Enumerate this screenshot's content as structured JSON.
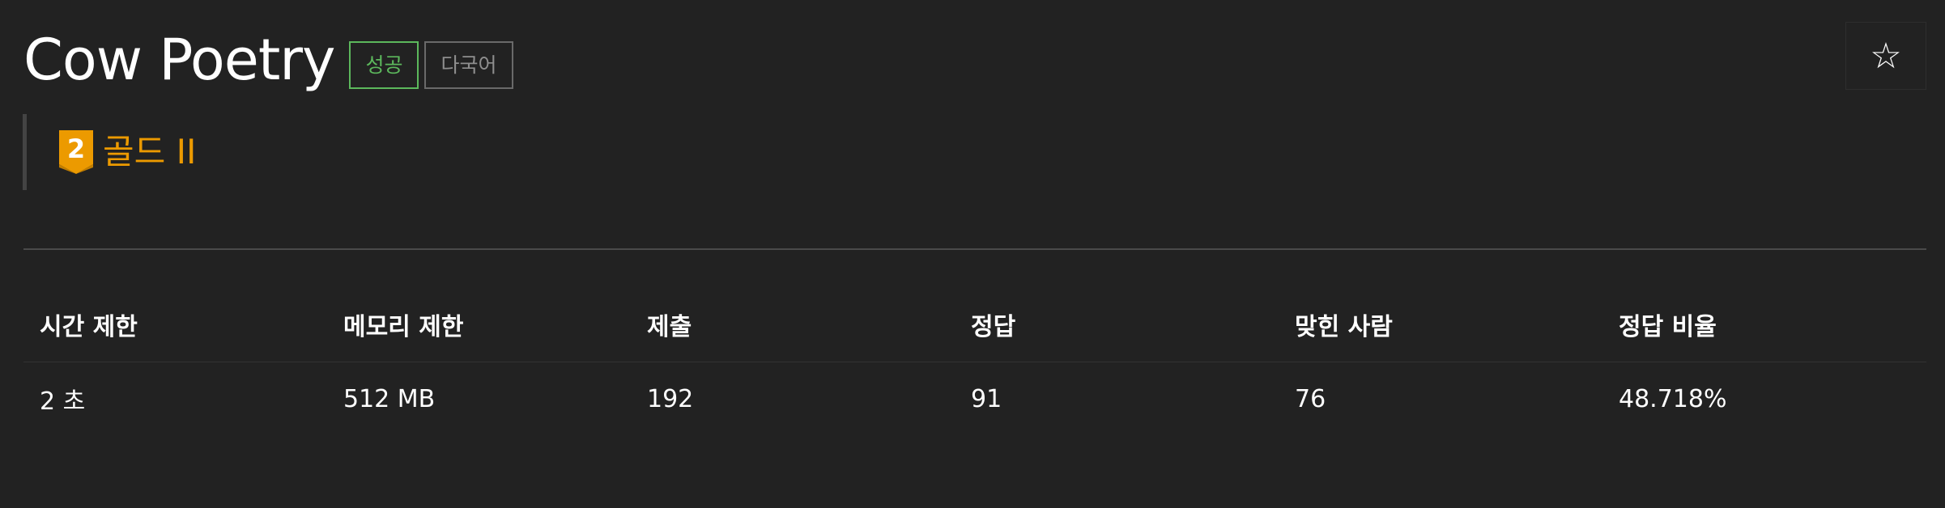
{
  "problem": {
    "title": "Cow Poetry",
    "badges": {
      "result": "성공",
      "language": "다국어"
    },
    "tier": {
      "level": "2",
      "label": "골드 II",
      "color": "#ec9a00"
    }
  },
  "actions": {
    "star_icon": "star-outline-icon",
    "star_glyph": "☆"
  },
  "info_table": {
    "headers": [
      "시간 제한",
      "메모리 제한",
      "제출",
      "정답",
      "맞힌 사람",
      "정답 비율"
    ],
    "values": [
      "2 초",
      "512 MB",
      "192",
      "91",
      "76",
      "48.718%"
    ]
  },
  "colors": {
    "background": "#222222",
    "success": "#5cb85c",
    "muted": "#8e8e8e",
    "tier_gold": "#ec9a00"
  }
}
